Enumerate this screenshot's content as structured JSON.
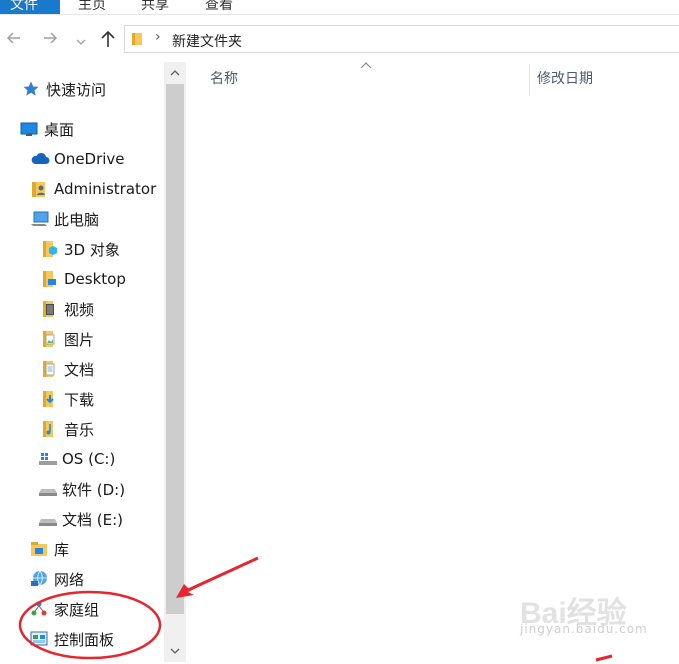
{
  "ribbon": {
    "tabs": [
      {
        "label": "文件"
      },
      {
        "label": "主页"
      },
      {
        "label": "共享"
      },
      {
        "label": "查看"
      }
    ]
  },
  "toolbar": {
    "back_icon": "arrow-left-icon",
    "forward_icon": "arrow-right-icon",
    "recent_icon": "chevron-down-icon",
    "up_icon": "arrow-up-icon"
  },
  "address": {
    "separator": "›",
    "path": "新建文件夹"
  },
  "navpane": {
    "items": [
      {
        "label": "快速访问",
        "icon": "star-icon"
      },
      {
        "label": "桌面",
        "icon": "desktop-icon"
      },
      {
        "label": "OneDrive",
        "icon": "cloud-icon"
      },
      {
        "label": "Administrator",
        "icon": "user-folder-icon"
      },
      {
        "label": "此电脑",
        "icon": "computer-icon"
      },
      {
        "label": "3D 对象",
        "icon": "folder-3d-icon"
      },
      {
        "label": "Desktop",
        "icon": "folder-desktop-icon"
      },
      {
        "label": "视频",
        "icon": "folder-video-icon"
      },
      {
        "label": "图片",
        "icon": "folder-picture-icon"
      },
      {
        "label": "文档",
        "icon": "folder-document-icon"
      },
      {
        "label": "下载",
        "icon": "folder-download-icon"
      },
      {
        "label": "音乐",
        "icon": "folder-music-icon"
      },
      {
        "label": "OS (C:)",
        "icon": "windows-drive-icon"
      },
      {
        "label": "软件 (D:)",
        "icon": "drive-icon"
      },
      {
        "label": "文档 (E:)",
        "icon": "drive-icon"
      },
      {
        "label": "库",
        "icon": "library-icon"
      },
      {
        "label": "网络",
        "icon": "network-icon"
      },
      {
        "label": "家庭组",
        "icon": "homegroup-icon"
      },
      {
        "label": "控制面板",
        "icon": "control-panel-icon"
      }
    ]
  },
  "scrollbar": {
    "up_glyph": "⌃",
    "down_glyph": "⌄"
  },
  "content": {
    "columns": [
      {
        "label": "名称"
      },
      {
        "label": "修改日期"
      }
    ],
    "sort_glyph": "^"
  },
  "watermark": {
    "brand": "Bai经验",
    "url": "jingyan.baidu.com"
  },
  "colors": {
    "accent": "#1979ca",
    "annotation": "#e5262e"
  }
}
